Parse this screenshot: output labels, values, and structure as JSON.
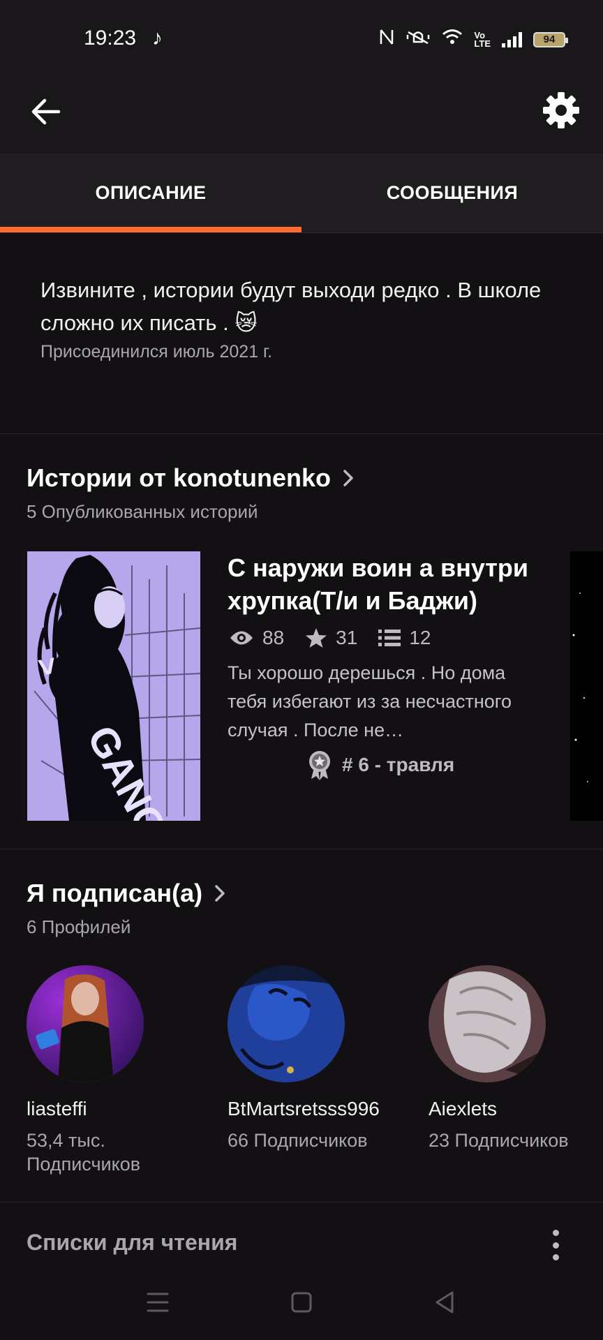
{
  "status_bar": {
    "time": "19:23",
    "battery": "94"
  },
  "tabs": [
    {
      "label": "ОПИСАНИЕ",
      "active": true
    },
    {
      "label": "СООБЩЕНИЯ",
      "active": false
    }
  ],
  "description": {
    "text": "Извините , истории будут выходи редко . В школе сложно их писать . 😿",
    "joined": "Присоединился июль 2021 г."
  },
  "stories_section": {
    "title": "Истории от konotunenko",
    "subtitle": "5 Опубликованных историй"
  },
  "story": {
    "title": "С наружи  воин а внутри хрупка(Т/и и Баджи)",
    "views": "88",
    "votes": "31",
    "parts": "12",
    "blurb": "Ты хорошо дерешься . Но дома тебя избегают из за несчастного случая . После не…",
    "rank": "# 6 - травля",
    "cover_text": "GANG"
  },
  "following_section": {
    "title": "Я подписан(а)",
    "subtitle": "6 Профилей"
  },
  "profiles": [
    {
      "name": "liasteffi",
      "followers": "53,4 тыс. Подписчиков"
    },
    {
      "name": "BtMartsretsss996",
      "followers": "66 Подписчиков"
    },
    {
      "name": "Aiexlets",
      "followers": "23 Подписчиков"
    }
  ],
  "reading_lists": {
    "title": "Списки для чтения"
  },
  "colors": {
    "accent": "#ff6a2f",
    "background": "#121013",
    "surface": "#1a171b",
    "muted_text": "#a9a7aa"
  }
}
